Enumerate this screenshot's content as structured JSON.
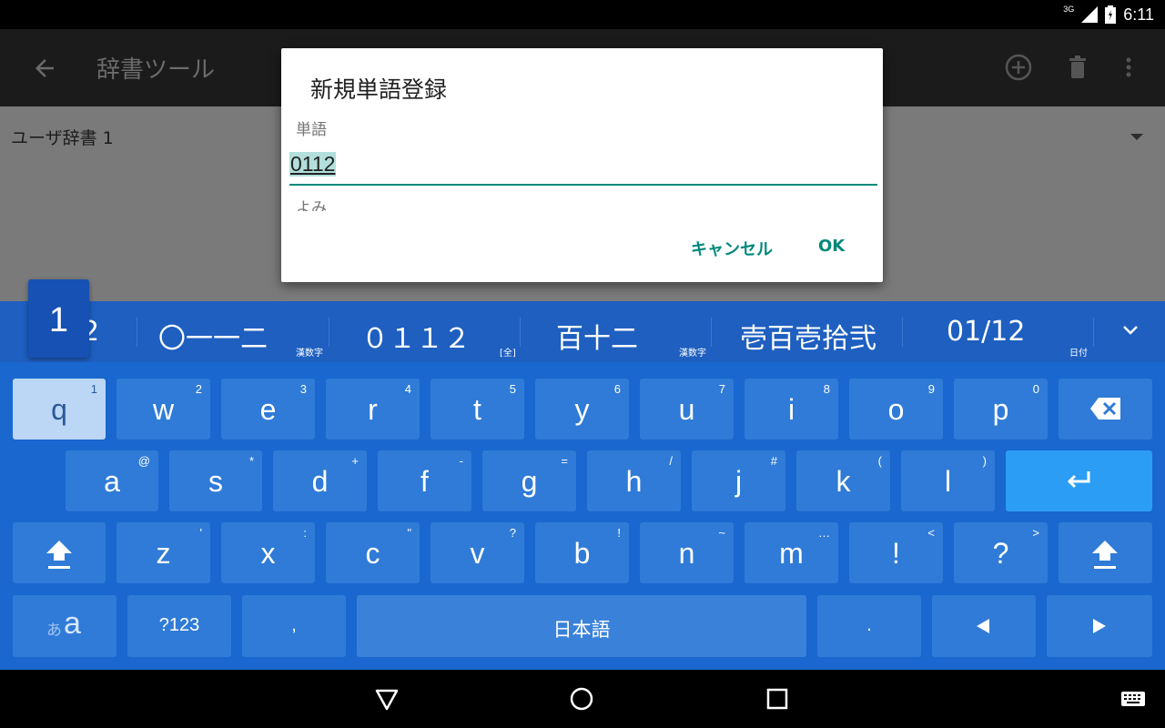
{
  "status_bar": {
    "network": "3G",
    "time": "6:11"
  },
  "app_bar": {
    "title": "辞書ツール",
    "icons": [
      "back-arrow-icon",
      "add-circle-icon",
      "trash-icon",
      "more-vert-icon"
    ]
  },
  "content": {
    "dictionary_name": "ユーザ辞書 1"
  },
  "dialog": {
    "title": "新規単語登録",
    "word_label": "単語",
    "word_value": "0112",
    "reading_label": "よみ",
    "cancel_label": "キャンセル",
    "ok_label": "OK"
  },
  "candidates": {
    "key_preview": "1",
    "items": [
      {
        "text": "2",
        "sub": ""
      },
      {
        "text": "〇一一二",
        "sub": "漢数字"
      },
      {
        "text": "０１１２",
        "sub": "[全]"
      },
      {
        "text": "百十二",
        "sub": "漢数字"
      },
      {
        "text": "壱百壱拾弐",
        "sub": "漢数字"
      },
      {
        "text": "01/12",
        "sub": "日付"
      }
    ]
  },
  "keyboard": {
    "row1": [
      {
        "k": "q",
        "s": "1"
      },
      {
        "k": "w",
        "s": "2"
      },
      {
        "k": "e",
        "s": "3"
      },
      {
        "k": "r",
        "s": "4"
      },
      {
        "k": "t",
        "s": "5"
      },
      {
        "k": "y",
        "s": "6"
      },
      {
        "k": "u",
        "s": "7"
      },
      {
        "k": "i",
        "s": "8"
      },
      {
        "k": "o",
        "s": "9"
      },
      {
        "k": "p",
        "s": "0"
      }
    ],
    "row2": [
      {
        "k": "a",
        "s": "@"
      },
      {
        "k": "s",
        "s": "*"
      },
      {
        "k": "d",
        "s": "+"
      },
      {
        "k": "f",
        "s": "-"
      },
      {
        "k": "g",
        "s": "="
      },
      {
        "k": "h",
        "s": "/"
      },
      {
        "k": "j",
        "s": "#"
      },
      {
        "k": "k",
        "s": "("
      },
      {
        "k": "l",
        "s": ")"
      }
    ],
    "row3": [
      {
        "k": "z",
        "s": "'"
      },
      {
        "k": "x",
        "s": ":"
      },
      {
        "k": "c",
        "s": "\""
      },
      {
        "k": "v",
        "s": "?"
      },
      {
        "k": "b",
        "s": "!"
      },
      {
        "k": "n",
        "s": "~"
      },
      {
        "k": "m",
        "s": "…"
      },
      {
        "k": "!",
        "s": "<"
      },
      {
        "k": "?",
        "s": ">"
      }
    ],
    "bottom": {
      "kana_a": "あ",
      "kana_b": "a",
      "symbols": "?123",
      "comma": ",",
      "space": "日本語",
      "period": "."
    }
  },
  "colors": {
    "accent": "#00897b",
    "keyboard_bg": "#1967cf",
    "key_bg": "#2f7bd7",
    "candidate_bg": "#1e5fc0",
    "enter_key": "#2b9df4"
  }
}
